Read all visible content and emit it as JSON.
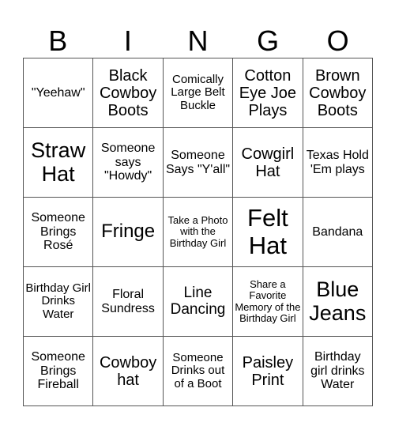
{
  "header": {
    "letters": [
      "B",
      "I",
      "N",
      "G",
      "O"
    ]
  },
  "card": {
    "cells": [
      [
        "\"Yeehaw\"",
        "Black Cowboy Boots",
        "Comically Large Belt Buckle",
        "Cotton Eye Joe Plays",
        "Brown Cowboy Boots"
      ],
      [
        "Straw Hat",
        "Someone says \"Howdy\"",
        "Someone Says \"Y'all\"",
        "Cowgirl Hat",
        "Texas Hold 'Em plays"
      ],
      [
        "Someone Brings Rosé",
        "Fringe",
        "Take a Photo with the Birthday Girl",
        "Felt Hat",
        "Bandana"
      ],
      [
        "Birthday Girl Drinks Water",
        "Floral Sundress",
        "Line Dancing",
        "Share a Favorite Memory of the Birthday Girl",
        "Blue Jeans"
      ],
      [
        "Someone Brings Fireball",
        "Cowboy hat",
        "Someone Drinks out of a Boot",
        "Paisley Print",
        "Birthday girl drinks Water"
      ]
    ]
  }
}
